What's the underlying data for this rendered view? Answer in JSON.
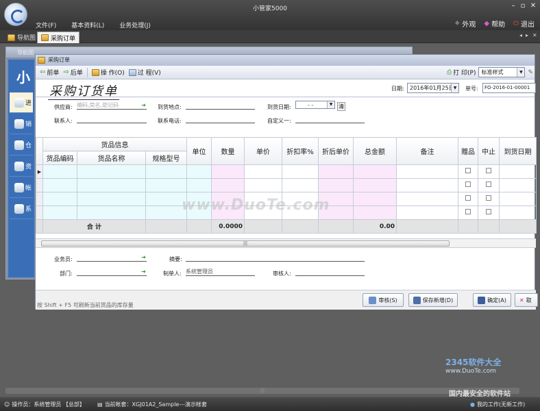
{
  "app": {
    "title": "小管家5000"
  },
  "menu": [
    "文件(F)",
    "基本资料(L)",
    "业务处理(J)"
  ],
  "right_tools": [
    "外观",
    "帮助",
    "退出"
  ],
  "nav_tabs": [
    "导航图",
    "采购订单"
  ],
  "bg_window": {
    "title": "导航图",
    "big_char": "小",
    "side_items": [
      "进",
      "销",
      "仓",
      "资",
      "帐",
      "系"
    ]
  },
  "window": {
    "title": "采购订单",
    "toolbar": {
      "prev": "前单",
      "next": "后单",
      "operate": "操 作(O)",
      "process": "过 程(V)",
      "print": "打 印(P)",
      "style": "标准样式"
    },
    "doc_title": "采购订货单",
    "date_label": "日期:",
    "date_value": "2016年01月25日",
    "no_label": "单号:",
    "no_value": "FO-2016-01-00001",
    "form": {
      "supplier_label": "供应商:",
      "supplier_placeholder": "编码,简名,助记码",
      "dest_label": "到货地点:",
      "arrival_label": "到货日期:",
      "arrival_value": "-  -",
      "clear_label": "清",
      "contact_label": "联系人:",
      "phone_label": "联系电话:",
      "custom_label": "自定义一:"
    },
    "grid": {
      "group_header": "货品信息",
      "columns": [
        "货品编码",
        "货品名称",
        "规格型号",
        "单位",
        "数量",
        "单价",
        "折扣率%",
        "折后单价",
        "总金额",
        "备注",
        "赠品",
        "中止",
        "到货日期"
      ],
      "total_label": "合 计",
      "total_qty": "0.0000",
      "total_amount": "0.00"
    },
    "bottom": {
      "salesman_label": "业务员:",
      "summary_label": "摘要:",
      "dept_label": "部门:",
      "maker_label": "制单人:",
      "maker_value": "系统管理员",
      "auditor_label": "审核人:"
    },
    "footer": {
      "hint": "按 Shift + F5 可刷新当前货品的库存量",
      "audit": "审核(S)",
      "save_new": "保存新增(D)",
      "confirm": "确定(A)",
      "cancel": "取"
    }
  },
  "status": {
    "operator": "操作员：系统管理员 【总部】",
    "account": "当前帐套：XGJ01A2_Sample---演示帐套",
    "work": "我的工作(无新工作)"
  },
  "watermarks": {
    "center": "www.DuoTe.com",
    "corner_site": "2345软件大全",
    "corner_url": "www.DuoTe.com",
    "corner_slogan": "国内最安全的软件站"
  }
}
